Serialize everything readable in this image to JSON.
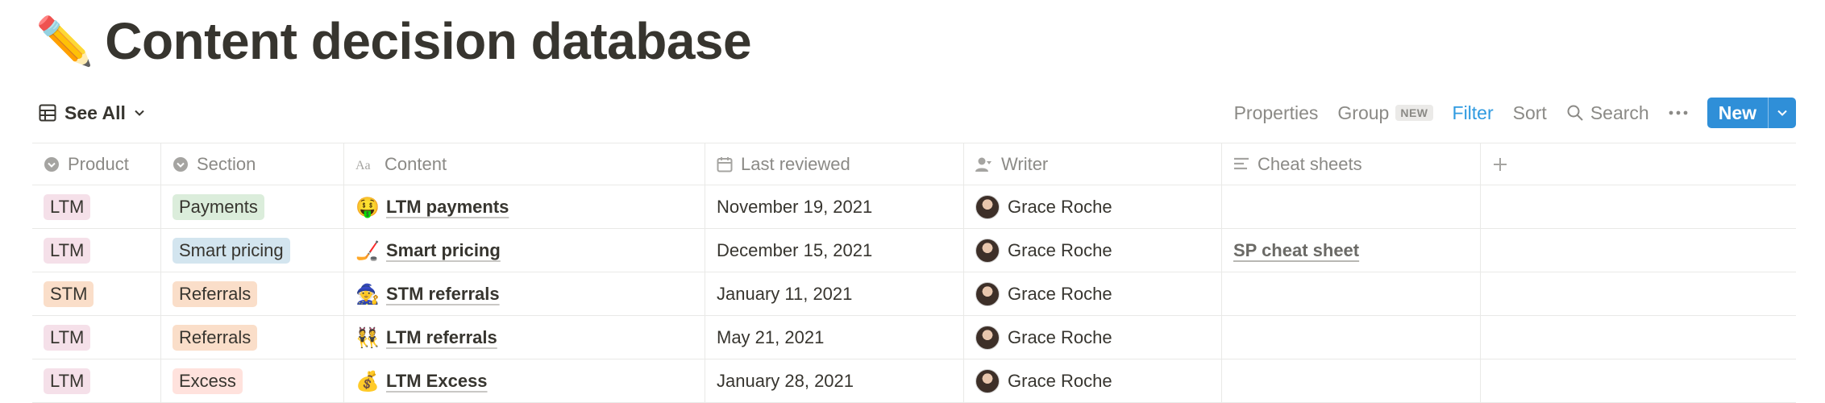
{
  "page": {
    "title_emoji": "✏️",
    "title": "Content decision database"
  },
  "toolbar": {
    "view_label": "See All",
    "properties": "Properties",
    "group": "Group",
    "group_badge": "NEW",
    "filter": "Filter",
    "sort": "Sort",
    "search": "Search",
    "new_button": "New",
    "accent_color": "#2f9ae0"
  },
  "table": {
    "columns": [
      "Product",
      "Section",
      "Content",
      "Last reviewed",
      "Writer",
      "Cheat sheets"
    ],
    "rows": [
      {
        "product": "LTM",
        "section": "Payments",
        "emoji": "🤑",
        "content": "LTM payments",
        "last_reviewed": "November 19, 2021",
        "writer": "Grace Roche",
        "cheat_sheet": ""
      },
      {
        "product": "LTM",
        "section": "Smart pricing",
        "emoji": "🏒",
        "content": "Smart pricing",
        "last_reviewed": "December 15, 2021",
        "writer": "Grace Roche",
        "cheat_sheet": "SP cheat sheet"
      },
      {
        "product": "STM",
        "section": "Referrals",
        "emoji": "🧙",
        "content": "STM referrals",
        "last_reviewed": "January 11, 2021",
        "writer": "Grace Roche",
        "cheat_sheet": ""
      },
      {
        "product": "LTM",
        "section": "Referrals",
        "emoji": "👯",
        "content": "LTM referrals",
        "last_reviewed": "May 21, 2021",
        "writer": "Grace Roche",
        "cheat_sheet": ""
      },
      {
        "product": "LTM",
        "section": "Excess",
        "emoji": "💰",
        "content": "LTM Excess",
        "last_reviewed": "January 28, 2021",
        "writer": "Grace Roche",
        "cheat_sheet": ""
      }
    ]
  }
}
